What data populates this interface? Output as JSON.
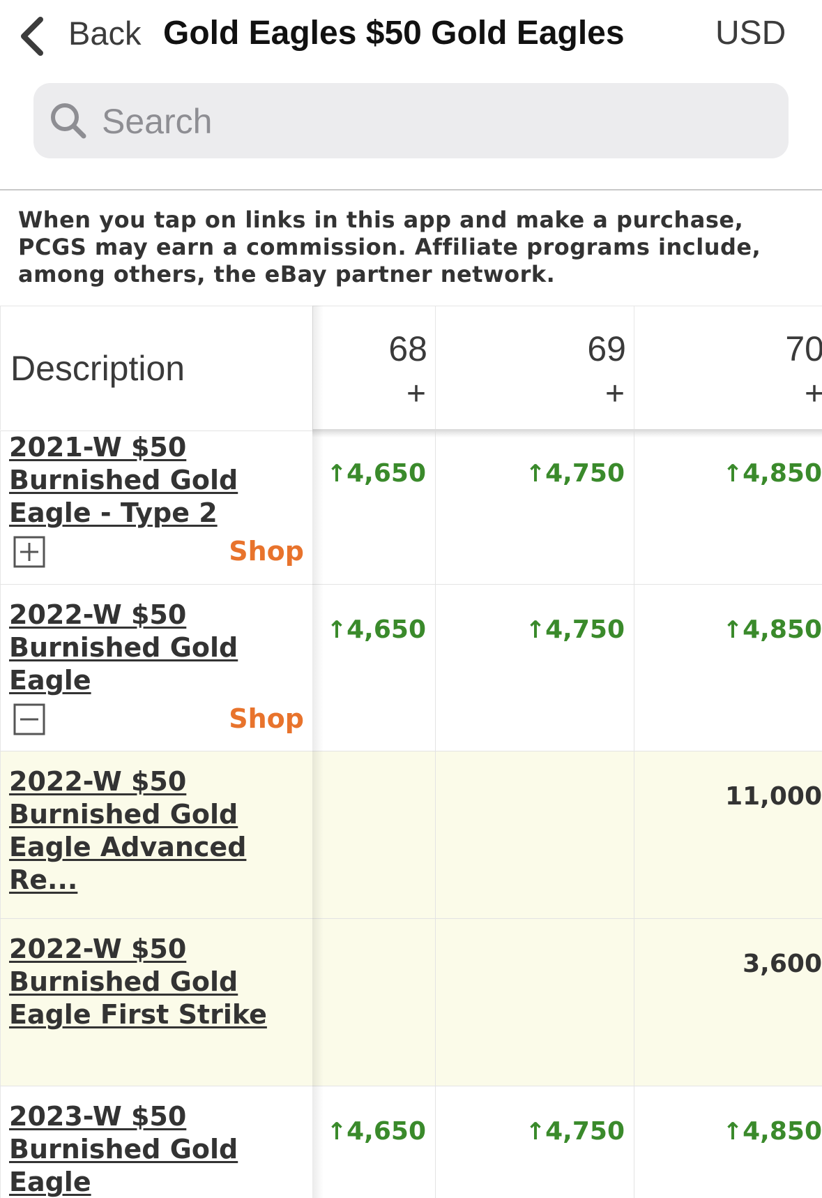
{
  "header": {
    "back_label": "Back",
    "title": "Gold Eagles $50 Gold Eagles",
    "currency": "USD"
  },
  "search": {
    "placeholder": "Search",
    "value": ""
  },
  "disclaimer": "When you tap on links in this app and make a purchase, PCGS may earn a commission. Affiliate programs include, among others, the eBay partner network.",
  "table": {
    "description_header": "Description",
    "grades": [
      {
        "grade": "68",
        "suffix": "+"
      },
      {
        "grade": "69",
        "suffix": "+"
      },
      {
        "grade": "70",
        "suffix": "+"
      }
    ],
    "shop_label": "Shop",
    "rows": [
      {
        "description": "2021-W $50 Burnished Gold Eagle - Type 2",
        "icon": "expand-icon",
        "prices": [
          "4,650",
          "4,750",
          "4,850"
        ],
        "trend": "up"
      },
      {
        "description": "2022-W $50 Burnished Gold Eagle",
        "icon": "collapse-icon",
        "prices": [
          "4,650",
          "4,750",
          "4,850"
        ],
        "trend": "up"
      },
      {
        "description": "2022-W $50 Burnished Gold Eagle Advanced Re...",
        "prices": [
          "",
          "",
          "11,000"
        ],
        "trend": "none"
      },
      {
        "description": "2022-W $50 Burnished Gold Eagle First Strike",
        "prices": [
          "",
          "",
          "3,600"
        ],
        "trend": "none"
      },
      {
        "description": "2023-W $50 Burnished Gold Eagle",
        "prices": [
          "4,650",
          "4,750",
          "4,850"
        ],
        "trend": "up"
      }
    ],
    "trend_arrow": "↑"
  },
  "colors": {
    "price_up": "#3a8a2b",
    "shop": "#e8732c",
    "highlight_row": "#fbfbe9"
  }
}
